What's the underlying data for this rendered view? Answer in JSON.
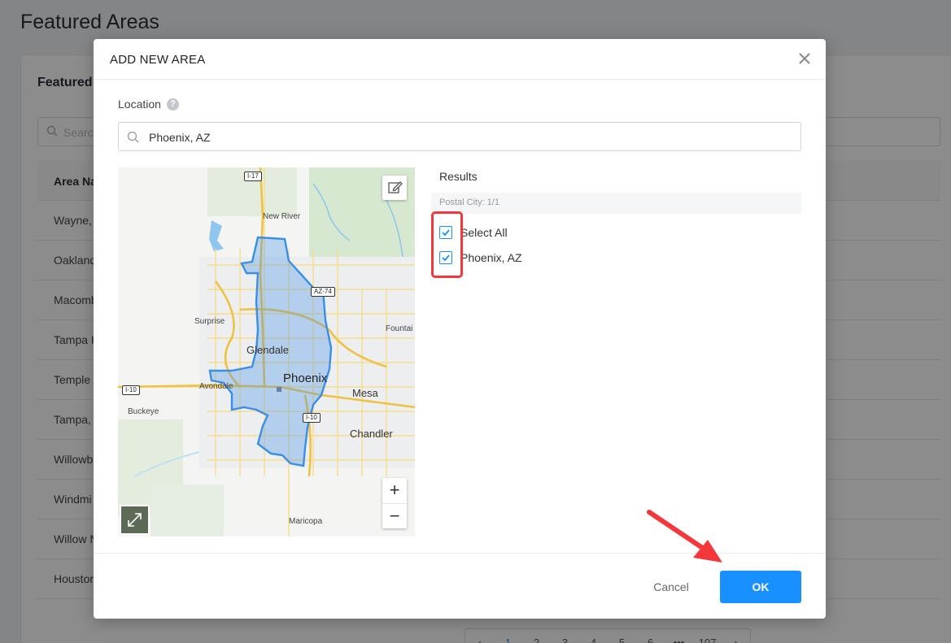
{
  "page": {
    "title": "Featured Areas",
    "card_title": "Featured",
    "search_placeholder": "Search",
    "table_header": "Area Na",
    "rows": [
      "Wayne,",
      "Oakland",
      "Macomb",
      "Tampa I",
      "Temple",
      "Tampa,",
      "Willowb",
      "Windmi",
      "Willow N",
      "Houston"
    ],
    "pagination": [
      "‹",
      "1",
      "2",
      "3",
      "4",
      "5",
      "6",
      "•••",
      "107",
      "›"
    ]
  },
  "modal": {
    "title": "ADD NEW AREA",
    "location_label": "Location",
    "help_icon": "?",
    "location_value": "Phoenix, AZ",
    "results_title": "Results",
    "results_group": "Postal City: 1/1",
    "options": [
      {
        "label": "Select All",
        "checked": true
      },
      {
        "label": "Phoenix, AZ",
        "checked": true
      }
    ],
    "cancel_label": "Cancel",
    "ok_label": "OK"
  },
  "map": {
    "labels": {
      "new_river": "New River",
      "surprise": "Surprise",
      "glendale": "Glendale",
      "phoenix": "Phoenix",
      "avondale": "Avondale",
      "buckeye": "Buckeye",
      "mesa": "Mesa",
      "chandler": "Chandler",
      "maricopa": "Maricopa",
      "fountain": "Fountai"
    },
    "shields": {
      "i17": "I-17",
      "az74": "AZ-74",
      "i10_west": "I-10",
      "i10_south": "I-10"
    },
    "zoom_in": "+",
    "zoom_out": "−"
  },
  "colors": {
    "primary": "#1890ff",
    "highlight": "#f5363b",
    "boundary": "#3b8ee8"
  }
}
